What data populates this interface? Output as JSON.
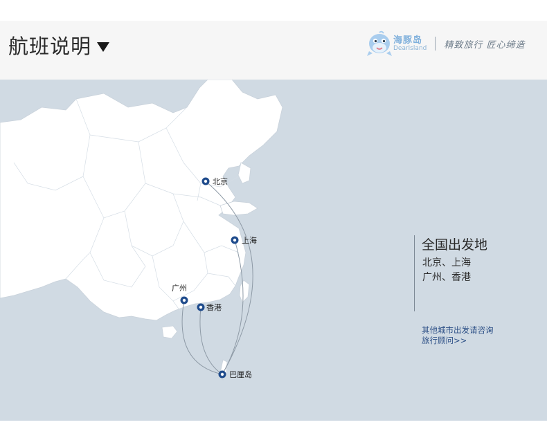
{
  "header": {
    "title": "航班说明",
    "brand": {
      "name_cn": "海豚岛",
      "name_en": "Dearisland",
      "slogan": "精致旅行 匠心缔造",
      "accent_color": "#7fb0dc"
    }
  },
  "map": {
    "land_color": "#ffffff",
    "sea_color": "#d0dae3",
    "route_color": "#8e9aa6",
    "marker_color": "#1f4b8c",
    "cities": [
      {
        "id": "beijing",
        "label": "北京"
      },
      {
        "id": "shanghai",
        "label": "上海"
      },
      {
        "id": "guangzhou",
        "label": "广州"
      },
      {
        "id": "hongkong",
        "label": "香港"
      },
      {
        "id": "bali",
        "label": "巴厘岛"
      }
    ]
  },
  "panel": {
    "title": "全国出发地",
    "cities_line1": "北京、上海",
    "cities_line2": "广州、香港",
    "link_line1": "其他城市出发请咨询",
    "link_line2": "旅行顾问>>"
  }
}
